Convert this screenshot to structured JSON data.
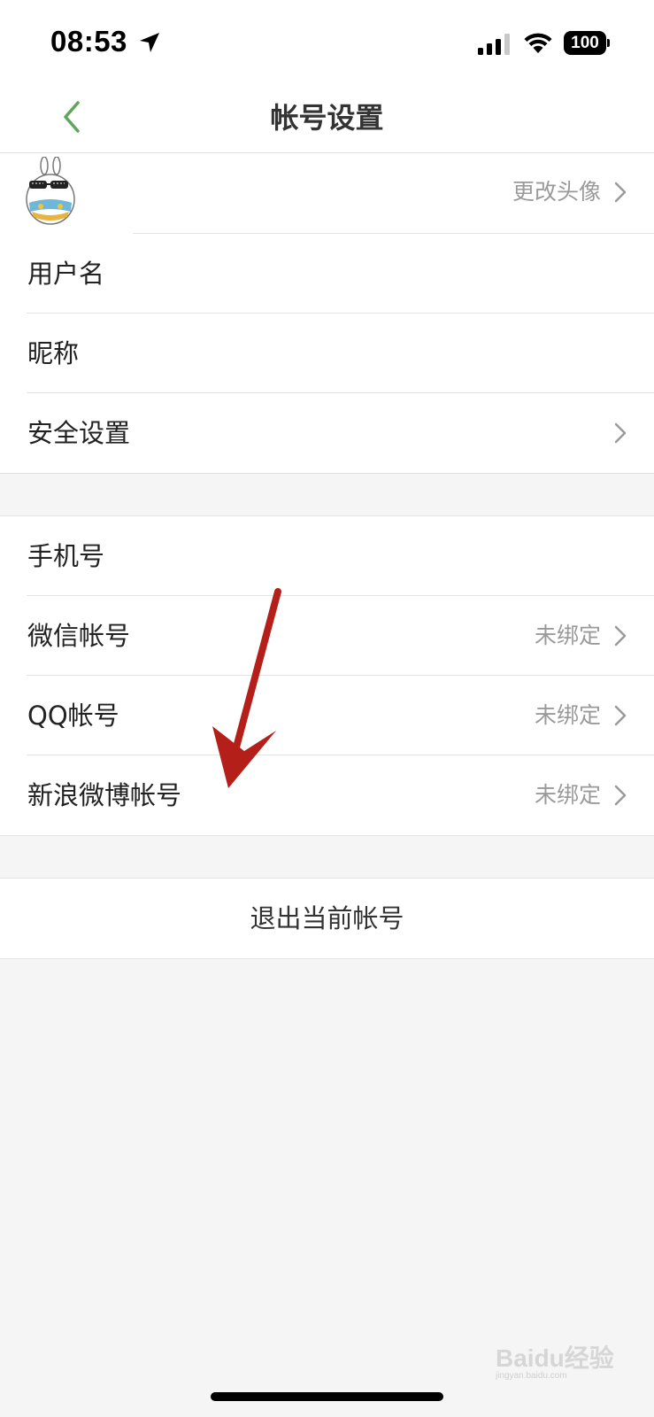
{
  "status_bar": {
    "time": "08:53",
    "battery": "100",
    "icons": [
      "location-arrow-icon",
      "signal-icon",
      "wifi-icon",
      "battery-icon"
    ]
  },
  "nav": {
    "title": "帐号设置",
    "back_icon": "chevron-left-icon",
    "accent_color": "#5fa55a"
  },
  "profile_group": {
    "avatar_row": {
      "value": "更改头像"
    },
    "username_row": {
      "label": "用户名"
    },
    "nickname_row": {
      "label": "昵称"
    },
    "security_row": {
      "label": "安全设置"
    }
  },
  "binding_group": {
    "phone_row": {
      "label": "手机号"
    },
    "wechat_row": {
      "label": "微信帐号",
      "value": "未绑定"
    },
    "qq_row": {
      "label": "QQ帐号",
      "value": "未绑定"
    },
    "weibo_row": {
      "label": "新浪微博帐号",
      "value": "未绑定"
    }
  },
  "logout": {
    "label": "退出当前帐号"
  },
  "annotation": {
    "arrow_color": "#b51f1a"
  },
  "watermark": {
    "text": "Baidu经验",
    "sub": "jingyan.baidu.com"
  }
}
